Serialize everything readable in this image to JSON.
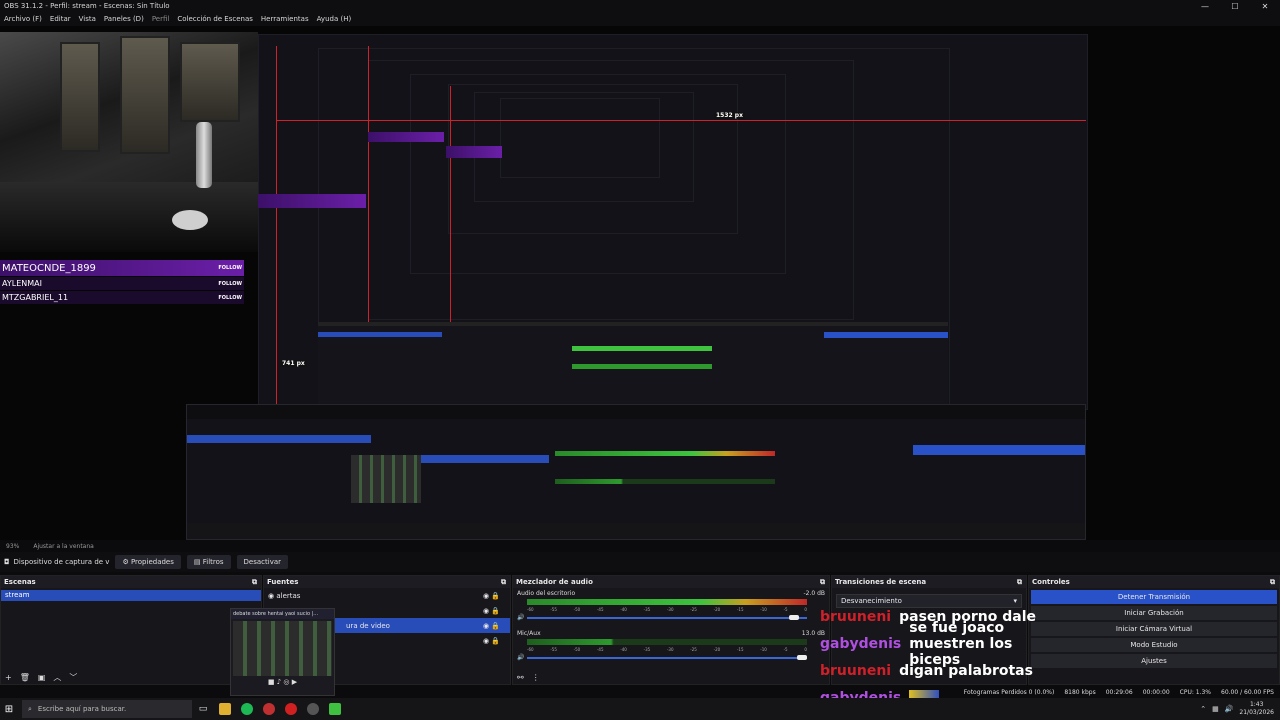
{
  "window": {
    "title": "OBS 31.1.2 - Perfil: stream - Escenas: Sin Título",
    "min": "—",
    "max": "☐",
    "close": "✕"
  },
  "menu": {
    "items": [
      "Archivo (F)",
      "Editar",
      "Vista",
      "Paneles (D)",
      "Perfil",
      "Colección de Escenas",
      "Herramientas",
      "Ayuda (H)"
    ]
  },
  "follow_overlay": {
    "rows": [
      {
        "name": "MATEOCNDE_1899",
        "action": "FOLLOW"
      },
      {
        "name": "AYLENMAI",
        "action": "FOLLOW"
      },
      {
        "name": "MTZGABRIEL_11",
        "action": "FOLLOW"
      }
    ]
  },
  "measures": {
    "width_label": "1532 px",
    "height_label": "741 px"
  },
  "status_top": {
    "zoom": "93%",
    "fit": "Ajustar a la ventana"
  },
  "toolbar": {
    "source_name": "Dispositivo de captura de v",
    "properties": "Propiedades",
    "filters": "Filtros",
    "deactivate": "Desactivar"
  },
  "scenes": {
    "title": "Escenas",
    "items": [
      "stream"
    ]
  },
  "sources": {
    "title": "Fuentes",
    "items": [
      "alertas",
      "ura de video"
    ],
    "popup_title": "debate sobre hentai yaoi sucio |..."
  },
  "mixer": {
    "title": "Mezclador de audio",
    "channels": [
      {
        "name": "Audio del escritorio",
        "db": "-2.0 dB"
      },
      {
        "name": "Mic/Aux",
        "db": "13.0 dB"
      }
    ],
    "scale": [
      "-60",
      "-55",
      "-50",
      "-45",
      "-40",
      "-35",
      "-30",
      "-25",
      "-20",
      "-15",
      "-10",
      "-5",
      "0"
    ]
  },
  "transitions": {
    "title": "Transiciones de escena",
    "selected": "Desvanecimiento"
  },
  "controls": {
    "title": "Controles",
    "buttons": [
      "Detener Transmisión",
      "Iniciar Grabación",
      "Iniciar Cámara Virtual",
      "Modo Estudio",
      "Ajustes"
    ]
  },
  "chat": [
    {
      "user": "bruuneni",
      "msg": "pasen porno dale",
      "color": "#d0202a"
    },
    {
      "user": "gabydenis",
      "msg": "se fue joaco muestren los biceps",
      "color": "#b050e0"
    },
    {
      "user": "bruuneni",
      "msg": "digan palabrotas",
      "color": "#d0202a"
    },
    {
      "user": "gabydenis",
      "msg": "",
      "color": "#b050e0"
    }
  ],
  "status_bar": {
    "dropped": "Fotogramas Perdidos 0 (0.0%)",
    "kbps": "8180 kbps",
    "time": "00:29:06",
    "rec": "00:00:00",
    "cpu": "CPU: 1.3%",
    "fps": "60.00 / 60.00 FPS"
  },
  "taskbar": {
    "search": "Escribe aquí para buscar.",
    "time": "1:43",
    "date": "21/03/2026"
  }
}
